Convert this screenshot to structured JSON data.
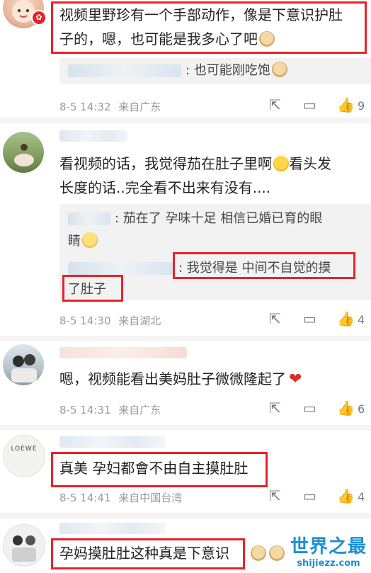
{
  "comments": [
    {
      "text": "视频里野珍有一个手部动作，像是下意识护肚子的，嗯，也可能是我多心了吧",
      "line1": "视频里野珍有一个手部动作，像是下意识护肚",
      "line2": "子的，嗯，也可能是我多心了吧",
      "reply1": ": 也可能刚吃饱",
      "time": "8-5 14:32",
      "location": "来自广东",
      "likes": "9"
    },
    {
      "line1": "看视频的话，我觉得茄在肚子里啊",
      "line1b": "看头发",
      "line2": "长度的话..完全看不出来有没有....",
      "reply1": ": 茄在了 孕味十足 相信已婚已育的眼",
      "reply1b": "睛",
      "reply2": ": 我觉得是  中间不自觉的摸",
      "reply2b": "了肚子",
      "time": "8-5 14:30",
      "location": "来自湖北",
      "likes": "4"
    },
    {
      "line1": "嗯，视频能看出美妈肚子微微隆起了",
      "time": "8-5 14:31",
      "location": "来自广东",
      "likes": "6"
    },
    {
      "line1": "真美 孕妇都會不由自主摸肚肚",
      "time": "8-5 14:41",
      "location": "来自中国台湾",
      "likes": "4",
      "avatar_text": "LOEWE"
    },
    {
      "line1": "孕妈摸肚肚这种真是下意识"
    }
  ],
  "icons": {
    "share": "share-icon",
    "comment": "comment-icon",
    "like": "thumbs-up-icon"
  },
  "watermark": {
    "title": "世界之最",
    "url": "shijiezz.com"
  },
  "colors": {
    "highlight": "#e8232b",
    "meta": "#9a9a9a",
    "watermark": "#1f8fd6"
  }
}
